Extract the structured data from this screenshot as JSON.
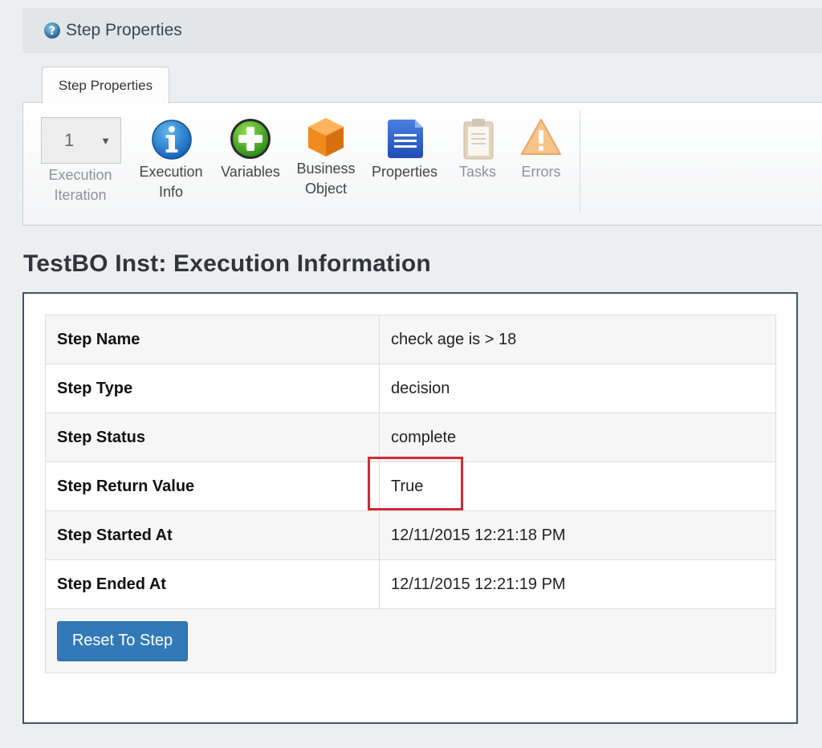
{
  "header": {
    "title": "Step Properties"
  },
  "tabs": [
    {
      "label": "Step Properties"
    }
  ],
  "ribbon": {
    "iteration": {
      "value": "1",
      "label_line1": "Execution",
      "label_line2": "Iteration"
    },
    "items": [
      {
        "line1": "Execution",
        "line2": "Info",
        "icon": "info-icon",
        "enabled": true
      },
      {
        "line1": "Variables",
        "line2": "",
        "icon": "plus-circle-icon",
        "enabled": true
      },
      {
        "line1": "Business",
        "line2": "Object",
        "icon": "cube-icon",
        "enabled": true
      },
      {
        "line1": "Properties",
        "line2": "",
        "icon": "document-icon",
        "enabled": true
      },
      {
        "line1": "Tasks",
        "line2": "",
        "icon": "clipboard-icon",
        "enabled": false
      },
      {
        "line1": "Errors",
        "line2": "",
        "icon": "warning-icon",
        "enabled": false
      }
    ]
  },
  "page_title": "TestBO Inst: Execution Information",
  "rows": [
    {
      "label": "Step Name",
      "value": "check age is > 18"
    },
    {
      "label": "Step Type",
      "value": "decision"
    },
    {
      "label": "Step Status",
      "value": "complete"
    },
    {
      "label": "Step Return Value",
      "value": "True"
    },
    {
      "label": "Step Started At",
      "value": "12/11/2015 12:21:18 PM"
    },
    {
      "label": "Step Ended At",
      "value": "12/11/2015 12:21:19 PM"
    }
  ],
  "actions": {
    "reset_label": "Reset To Step"
  },
  "colors": {
    "accent": "#3279b7",
    "highlight": "#d42a35",
    "panel_border": "#40546a"
  }
}
